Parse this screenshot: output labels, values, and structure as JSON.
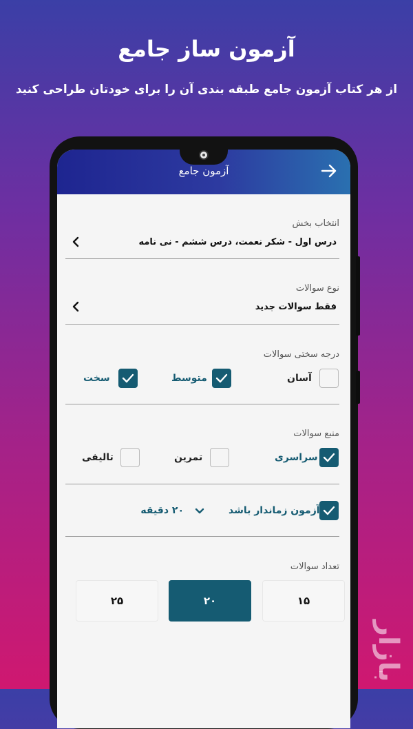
{
  "promo": {
    "title": "آزمون ساز جامع",
    "subtitle": "از هر کتاب آزمون جامع طبقه بندی آن را برای خودتان طراحی کنید"
  },
  "app": {
    "header_title": "آزمون جامع",
    "back_icon": "arrow-right-icon"
  },
  "form": {
    "section": {
      "label": "انتخاب بخش",
      "value": "درس اول - شکر نعمت، درس ششم - نی نامه"
    },
    "question_type": {
      "label": "نوع سوالات",
      "value": "فقط سوالات جدید"
    },
    "difficulty": {
      "label": "درجه سختی سوالات",
      "options": [
        {
          "label": "آسان",
          "checked": false
        },
        {
          "label": "متوسط",
          "checked": true
        },
        {
          "label": "سخت",
          "checked": true
        }
      ]
    },
    "source": {
      "label": "منبع سوالات",
      "options": [
        {
          "label": "سراسری",
          "checked": true
        },
        {
          "label": "تمرین",
          "checked": false
        },
        {
          "label": "تالیفی",
          "checked": false
        }
      ]
    },
    "timed": {
      "label": "آزمون زماندار باشد",
      "checked": true,
      "duration": "۲۰ دقیقه"
    },
    "count": {
      "label": "تعداد سوالات",
      "options": [
        "۱۵",
        "۲۰",
        "۲۵"
      ],
      "selected": "۲۰"
    }
  },
  "watermark": "بازار",
  "colors": {
    "accent": "#155b72",
    "header_start": "#1e2590",
    "header_end": "#2a70b0"
  }
}
